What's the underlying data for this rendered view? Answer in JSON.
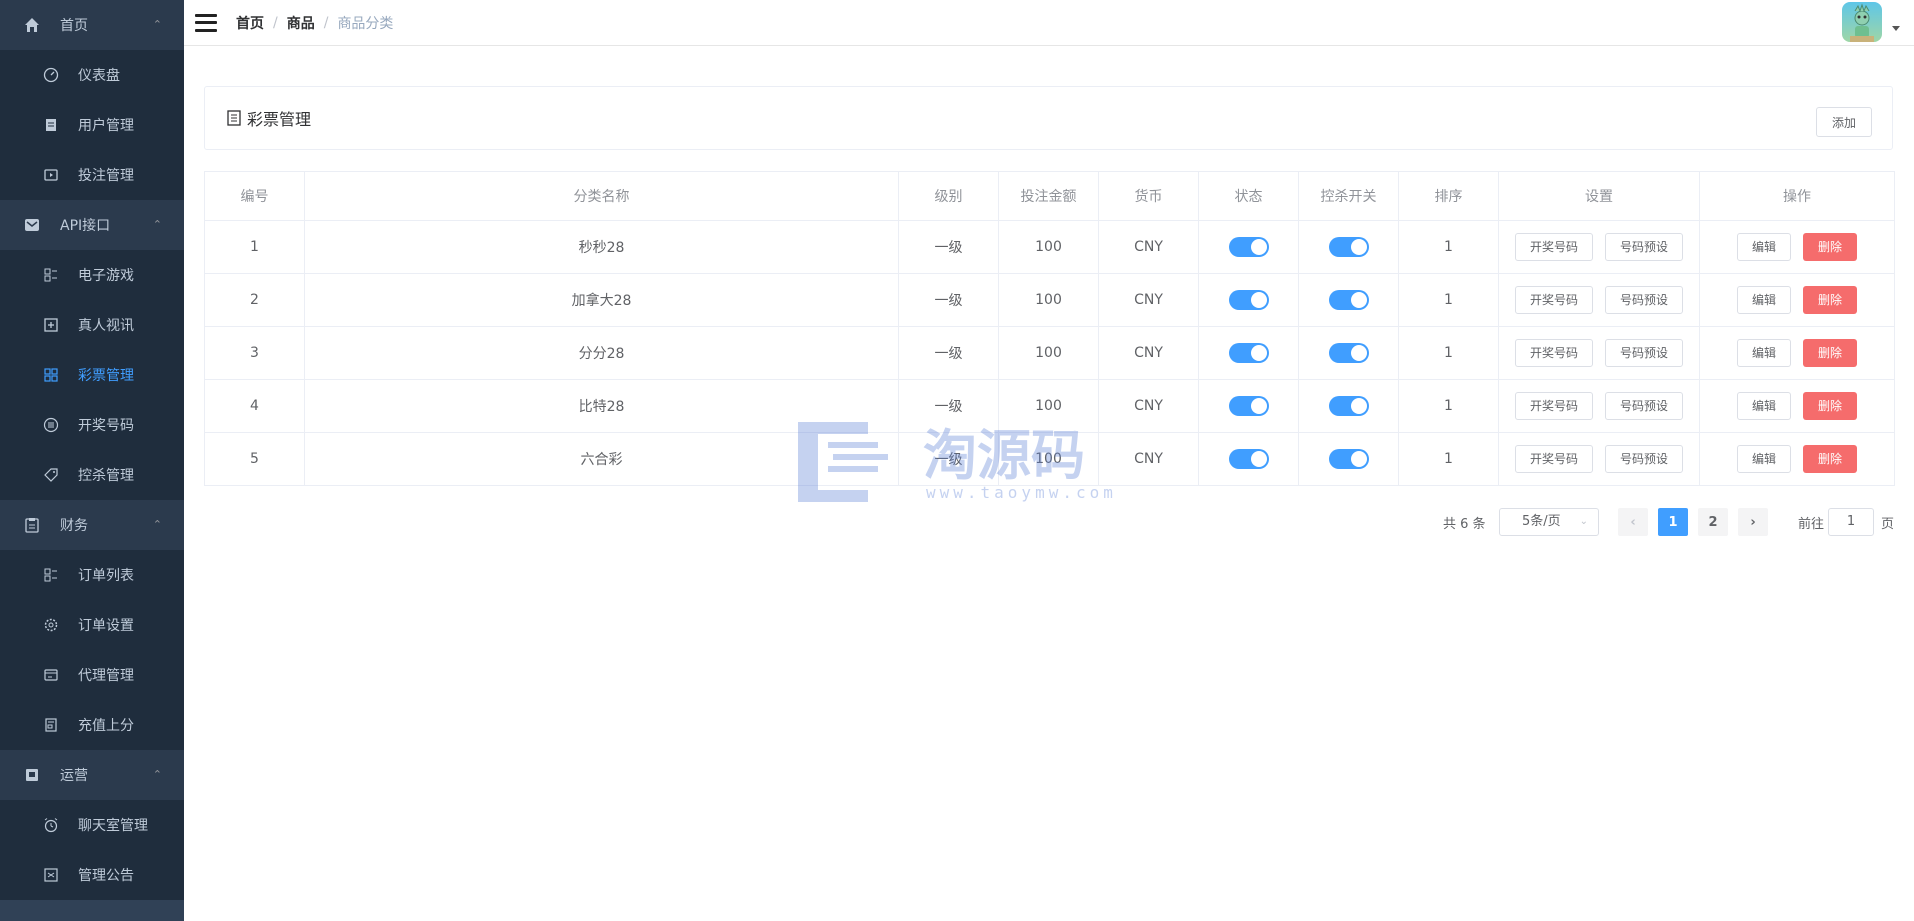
{
  "sidebar": {
    "groups": [
      {
        "label": "首页",
        "icon": "home-icon",
        "items": [
          {
            "label": "仪表盘",
            "icon": "dashboard-icon"
          },
          {
            "label": "用户管理",
            "icon": "document-icon"
          },
          {
            "label": "投注管理",
            "icon": "monitor-icon"
          }
        ]
      },
      {
        "label": "API接口",
        "icon": "mail-icon",
        "items": [
          {
            "label": "电子游戏",
            "icon": "list-icon"
          },
          {
            "label": "真人视讯",
            "icon": "plus-square-icon"
          },
          {
            "label": "彩票管理",
            "icon": "grid-icon",
            "active": true
          },
          {
            "label": "开奖号码",
            "icon": "list-circle-icon"
          },
          {
            "label": "控杀管理",
            "icon": "tag-icon"
          }
        ]
      },
      {
        "label": "财务",
        "icon": "clipboard-icon",
        "items": [
          {
            "label": "订单列表",
            "icon": "list-icon"
          },
          {
            "label": "订单设置",
            "icon": "gear-icon"
          },
          {
            "label": "代理管理",
            "icon": "wallet-icon"
          },
          {
            "label": "充值上分",
            "icon": "receipt-icon"
          }
        ]
      },
      {
        "label": "运营",
        "icon": "flag-icon",
        "items": [
          {
            "label": "聊天室管理",
            "icon": "alarm-icon"
          },
          {
            "label": "管理公告",
            "icon": "notice-icon"
          }
        ]
      }
    ]
  },
  "breadcrumb": [
    "首页",
    "商品",
    "商品分类"
  ],
  "card": {
    "title": "彩票管理",
    "add_label": "添加"
  },
  "table": {
    "headers": [
      "编号",
      "分类名称",
      "级别",
      "投注金额",
      "货币",
      "状态",
      "控杀开关",
      "排序",
      "设置",
      "操作"
    ],
    "rows": [
      {
        "id": "1",
        "name": "秒秒28",
        "level": "一级",
        "amount": "100",
        "currency": "CNY",
        "status": true,
        "kill": true,
        "sort": "1"
      },
      {
        "id": "2",
        "name": "加拿大28",
        "level": "一级",
        "amount": "100",
        "currency": "CNY",
        "status": true,
        "kill": true,
        "sort": "1"
      },
      {
        "id": "3",
        "name": "分分28",
        "level": "一级",
        "amount": "100",
        "currency": "CNY",
        "status": true,
        "kill": true,
        "sort": "1"
      },
      {
        "id": "4",
        "name": "比特28",
        "level": "一级",
        "amount": "100",
        "currency": "CNY",
        "status": true,
        "kill": true,
        "sort": "1"
      },
      {
        "id": "5",
        "name": "六合彩",
        "level": "一级",
        "amount": "100",
        "currency": "CNY",
        "status": true,
        "kill": true,
        "sort": "1"
      }
    ],
    "btn_draw": "开奖号码",
    "btn_preset": "号码预设",
    "btn_edit": "编辑",
    "btn_delete": "删除"
  },
  "pagination": {
    "total": "共 6 条",
    "page_size": "5条/页",
    "pages": [
      "1",
      "2"
    ],
    "current": "1",
    "goto_label": "前往",
    "goto_value": "1",
    "page_suffix": "页"
  },
  "watermark": {
    "text": "淘源码",
    "url": "www.taoymw.com"
  },
  "colors": {
    "sidebar": "#304156",
    "accent": "#409eff",
    "danger": "#f56c6c"
  }
}
